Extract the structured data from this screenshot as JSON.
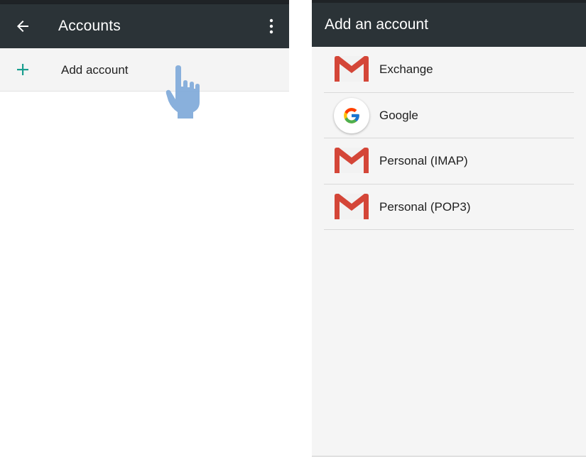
{
  "left_screen": {
    "appbar": {
      "title": "Accounts",
      "back_icon": "arrow-back-icon",
      "overflow_icon": "more-vert-icon"
    },
    "add_row": {
      "label": "Add account",
      "icon": "plus-icon"
    },
    "gesture_icon": "tap-hand-icon"
  },
  "right_screen": {
    "header": {
      "title": "Add an account"
    },
    "accounts": [
      {
        "label": "Exchange",
        "icon": "gmail-icon"
      },
      {
        "label": "Google",
        "icon": "google-g-icon"
      },
      {
        "label": "Personal (IMAP)",
        "icon": "gmail-icon"
      },
      {
        "label": "Personal (POP3)",
        "icon": "gmail-icon"
      }
    ]
  },
  "colors": {
    "appbar": "#2b3337",
    "statusbar": "#1f2326",
    "accent_plus": "#1a9e8f",
    "gmail_red": "#d44638",
    "hand": "#7fa9d9"
  }
}
